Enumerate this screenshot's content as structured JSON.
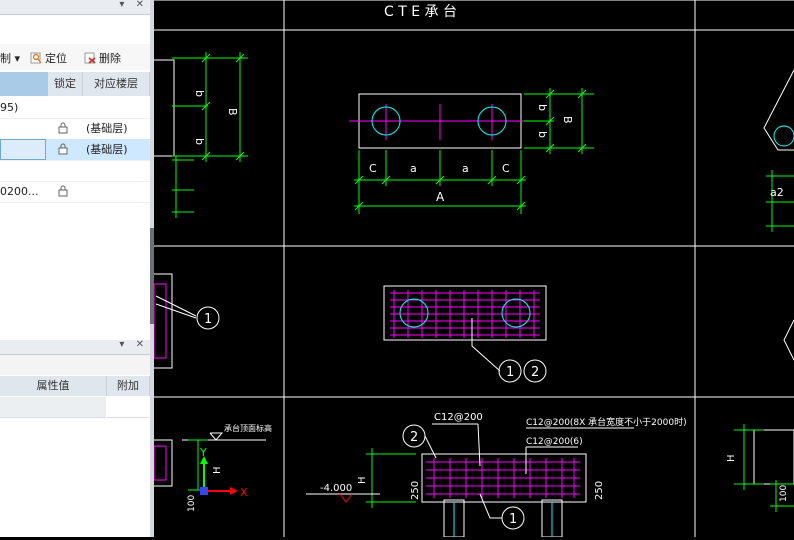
{
  "left_panel": {
    "toolbar": {
      "partial_label": "制",
      "locate_label": "定位",
      "delete_label": "删除"
    },
    "table": {
      "headers": [
        "锁定",
        "对应楼层"
      ],
      "rows": [
        {
          "name": "95)",
          "locked": false,
          "floor": ""
        },
        {
          "name": "",
          "locked": true,
          "floor": "(基础层)"
        },
        {
          "name": "",
          "locked": true,
          "floor": "(基础层)",
          "selected": true
        },
        {
          "name": "",
          "locked": false,
          "floor": ""
        },
        {
          "name": "0200...",
          "locked": true,
          "floor": ""
        }
      ]
    },
    "props": {
      "headers": [
        "属性值",
        "附加"
      ]
    }
  },
  "cad": {
    "top_title": "C T E    承 台",
    "labels": {
      "b": "b",
      "B": "B",
      "C": "C",
      "a": "a",
      "A": "A",
      "a2": "a2",
      "one": "1",
      "two": "2",
      "H": "H",
      "y": "Y",
      "x": "X",
      "elev_label": "承台顶面标高",
      "minus4": "-4.000",
      "n250": "250",
      "n100": "100",
      "rebar1": "C12@200",
      "rebar2": "C12@200(8X 承台宽度不小于2000时)",
      "rebar3": "C12@200(6)"
    },
    "colors": {
      "dim": "#00ff00",
      "outline": "#ffffff",
      "rebar": "#ff00ff",
      "circle": "#00ffff",
      "axis": "#ff0000",
      "background": "#000000"
    }
  }
}
